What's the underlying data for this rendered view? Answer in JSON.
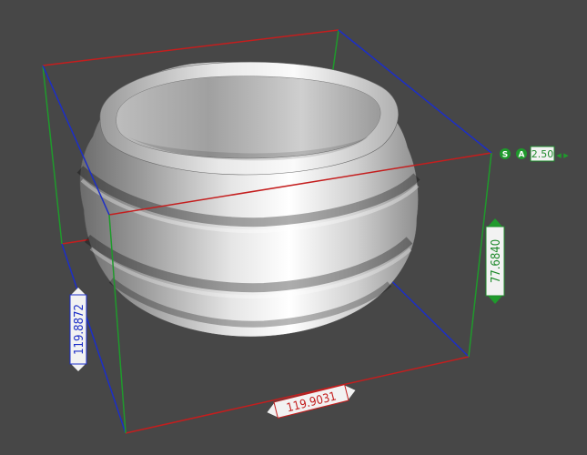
{
  "viewport": {
    "background": "#474747"
  },
  "colors": {
    "x_axis": "#c41e1e",
    "y_axis": "#1c2ec8",
    "z_axis": "#1f9a2c",
    "label_red": "#c41e1e",
    "label_blue": "#1c2ec8",
    "label_green": "#1f8a2c",
    "label_bg": "#f2f2f2"
  },
  "dimensions": {
    "width": "119.9031",
    "depth": "119.8872",
    "height": "77.6840"
  },
  "snap_control": {
    "s_label": "S",
    "a_label": "A",
    "value": "2.50",
    "left_arrow": "◂",
    "right_arrow": "▸"
  },
  "icons": {
    "arrow_left": "left-arrow-icon",
    "arrow_right": "right-arrow-icon",
    "arrow_up": "up-arrow-icon",
    "arrow_down": "down-arrow-icon"
  }
}
